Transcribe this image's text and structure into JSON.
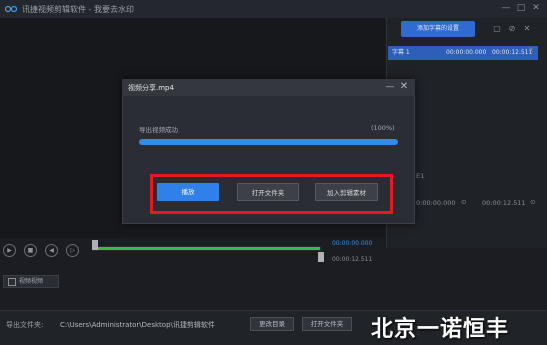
{
  "app": {
    "title": "讯捷视频剪辑软件  -  我要去水印",
    "window_controls": {
      "minimize": "—",
      "maximize": "□",
      "close": "✕"
    }
  },
  "right_panel": {
    "add_subtitle_label": "添加字幕的设置",
    "subtitle_row": {
      "index": "字幕 1",
      "start": "00:00:00.000",
      "end": "00:00:12.511"
    },
    "mid_label": "E1",
    "time_start": "0:00:00.000",
    "time_end": "00:00:12.511"
  },
  "dialog": {
    "title": "视频分享.mp4",
    "status": "导出视频成功",
    "percent_label": "(100%)",
    "progress": 1.0,
    "buttons": {
      "play": "播放",
      "open_folder": "打开文件夹",
      "add_material": "加入剪辑素材"
    },
    "highlight_color": "#e01c22"
  },
  "playback": {
    "time_current": "00:00:00.000",
    "time_total": "00:00:12.511",
    "video_tab_label": "视频视频"
  },
  "bottom": {
    "export_label": "导出文件夹:",
    "export_path": "C:\\Users\\Administrator\\Desktop\\讯捷剪辑软件",
    "change_dir": "更改目录",
    "open_folder": "打开文件夹"
  },
  "watermark": "北京一诺恒丰",
  "colors": {
    "accent": "#2f80e8",
    "progress": "#2f8de8",
    "timeline": "#2fbf4f",
    "bg": "#1b1d22"
  }
}
